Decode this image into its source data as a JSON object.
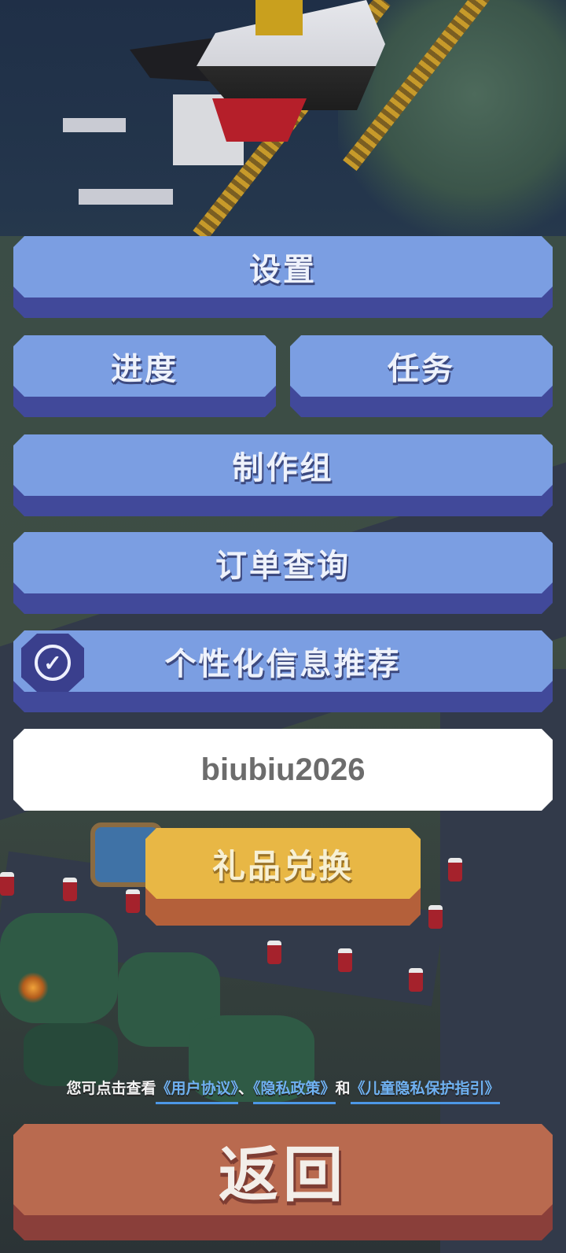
{
  "menu": {
    "settings": "设置",
    "progress": "进度",
    "tasks": "任务",
    "credits": "制作组",
    "order_query": "订单查询",
    "personalized": "个性化信息推荐",
    "personalized_checked": "true"
  },
  "redeem": {
    "code_value": "biubiu2026",
    "gift_button": "礼品兑换"
  },
  "legal": {
    "prefix": "您可点击查看",
    "user_agreement": "《用户协议》",
    "separator": "、",
    "privacy_policy": "《隐私政策》",
    "and": "和",
    "child_privacy": "《儿童隐私保护指引》"
  },
  "back_button": "返回",
  "colors": {
    "button_face": "#7b9ee2",
    "button_base": "#41499a",
    "gift_face": "#e8b745",
    "back_face": "#b96a4f",
    "link": "#6fb1f1"
  },
  "icons": {
    "check": "check-circle-icon"
  }
}
